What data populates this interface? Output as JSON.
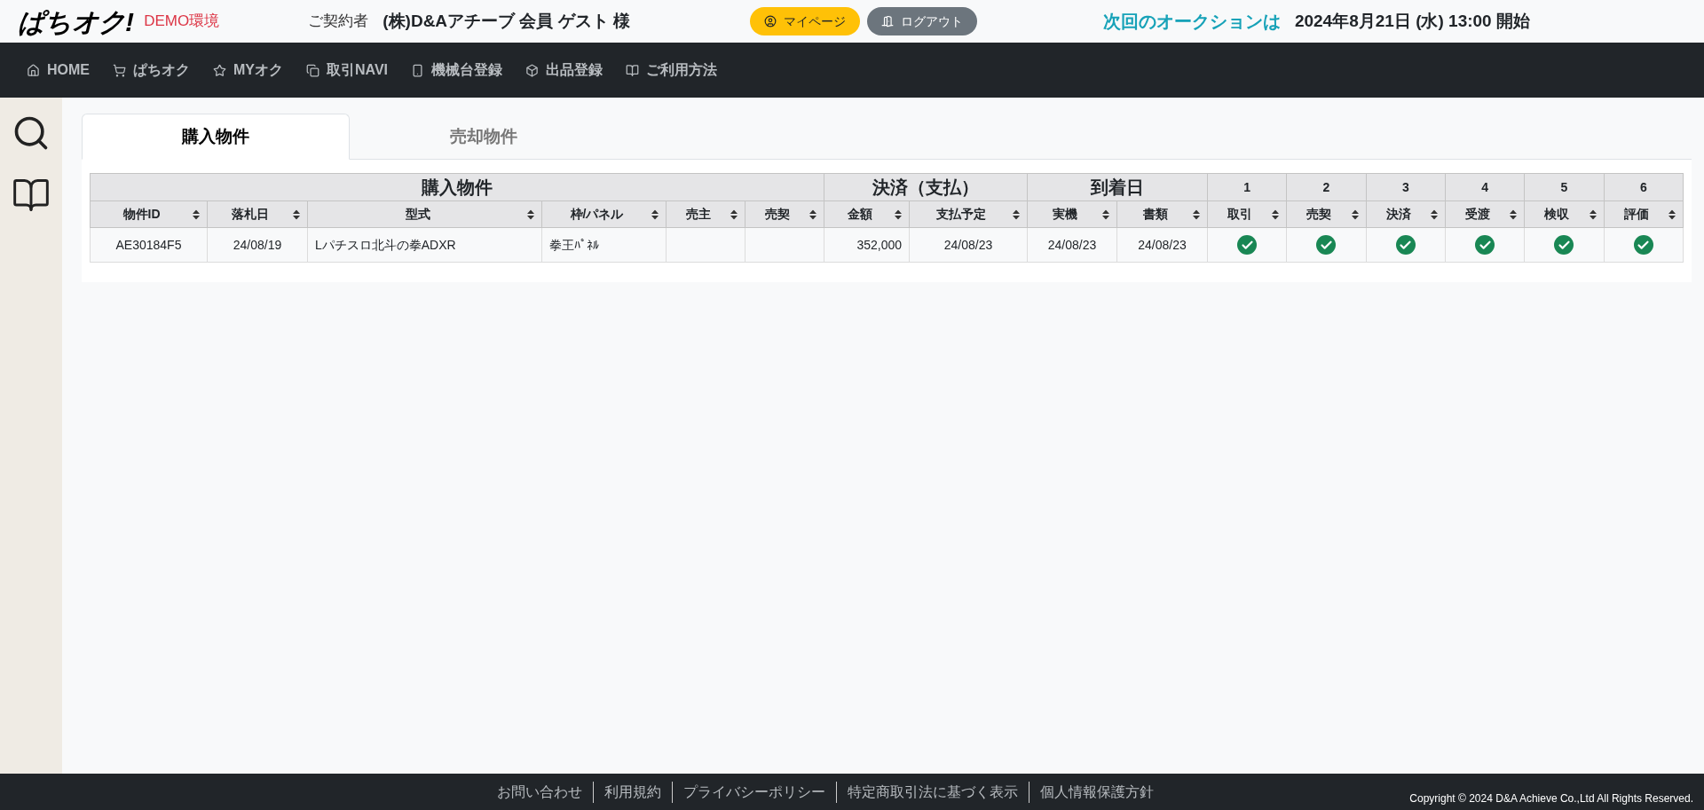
{
  "header": {
    "logo": "ぱちオク!",
    "environment": "DEMO環境",
    "contractor_label": "ご契約者",
    "contractor_name": "(株)D&Aアチーブ 会員 ゲスト 様",
    "mypage_button": "マイページ",
    "logout_button": "ログアウト",
    "next_auction_label": "次回のオークションは",
    "next_auction_date": "2024年8月21日 (水) 13:00 開始"
  },
  "nav": [
    {
      "kind": "home",
      "label": "HOME"
    },
    {
      "kind": "cart",
      "label": "ぱちオク"
    },
    {
      "kind": "star",
      "label": "MYオク"
    },
    {
      "kind": "copy",
      "label": "取引NAVI"
    },
    {
      "kind": "device",
      "label": "機械台登録"
    },
    {
      "kind": "box",
      "label": "出品登録"
    },
    {
      "kind": "book",
      "label": "ご利用方法"
    }
  ],
  "tabs": [
    {
      "label": "購入物件",
      "selected": true
    },
    {
      "label": "売却物件",
      "selected": false
    }
  ],
  "table": {
    "groups": [
      {
        "title": "購入物件",
        "columns": [
          "物件ID",
          "落札日",
          "型式",
          "枠/パネル",
          "売主",
          "売契"
        ]
      },
      {
        "title": "決済（支払）",
        "columns": [
          "金額",
          "支払予定"
        ]
      },
      {
        "title": "到着日",
        "columns": [
          "実機",
          "書類"
        ]
      },
      {
        "title": "1",
        "columns": [
          "取引"
        ]
      },
      {
        "title": "2",
        "columns": [
          "売契"
        ]
      },
      {
        "title": "3",
        "columns": [
          "決済"
        ]
      },
      {
        "title": "4",
        "columns": [
          "受渡"
        ]
      },
      {
        "title": "5",
        "columns": [
          "検収"
        ]
      },
      {
        "title": "6",
        "columns": [
          "評価"
        ]
      }
    ],
    "rows": [
      {
        "cells": [
          "AE30184F5",
          "24/08/19",
          "Lパチスロ北斗の拳ADXR",
          "拳王ﾊﾟﾈﾙ",
          "",
          "",
          "352,000",
          "24/08/23",
          "24/08/23",
          "24/08/23"
        ],
        "steps": [
          {
            "done": true
          },
          {
            "done": true
          },
          {
            "done": true
          },
          {
            "done": true
          },
          {
            "done": true
          },
          {
            "done": true
          }
        ]
      }
    ]
  },
  "footer": {
    "links": [
      "お問い合わせ",
      "利用規約",
      "プライバシーポリシー",
      "特定商取引法に基づく表示",
      "個人情報保護方針"
    ],
    "copyright": "Copyright © 2024 D&A Achieve Co.,Ltd All Rights Reserved."
  }
}
